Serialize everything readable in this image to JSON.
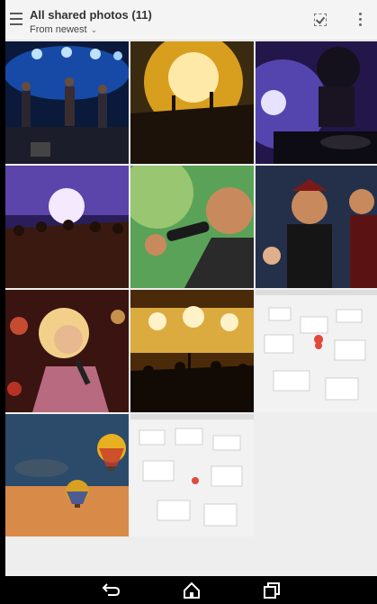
{
  "app_bar": {
    "title": "All shared photos (11)",
    "sort_label": "From newest",
    "icons": {
      "menu": "hamburger-menu-icon",
      "select": "multi-select-icon",
      "more": "more-vertical-icon",
      "sort_dropdown": "chevron-down-icon"
    }
  },
  "photos": [
    {
      "subject": "band playing on stage"
    },
    {
      "subject": "concert crowd with raised hands"
    },
    {
      "subject": "dj at turntables"
    },
    {
      "subject": "crowd facing stage lights"
    },
    {
      "subject": "man singing into microphone"
    },
    {
      "subject": "singers with microphones"
    },
    {
      "subject": "woman singing with microphone"
    },
    {
      "subject": "concert crowd under spotlights"
    },
    {
      "subject": "3d city map"
    },
    {
      "subject": "hot air balloons in sky"
    },
    {
      "subject": "3d city map with pin"
    }
  ],
  "nav_bar": {
    "icons": [
      "back-icon",
      "home-icon",
      "recents-icon"
    ]
  }
}
